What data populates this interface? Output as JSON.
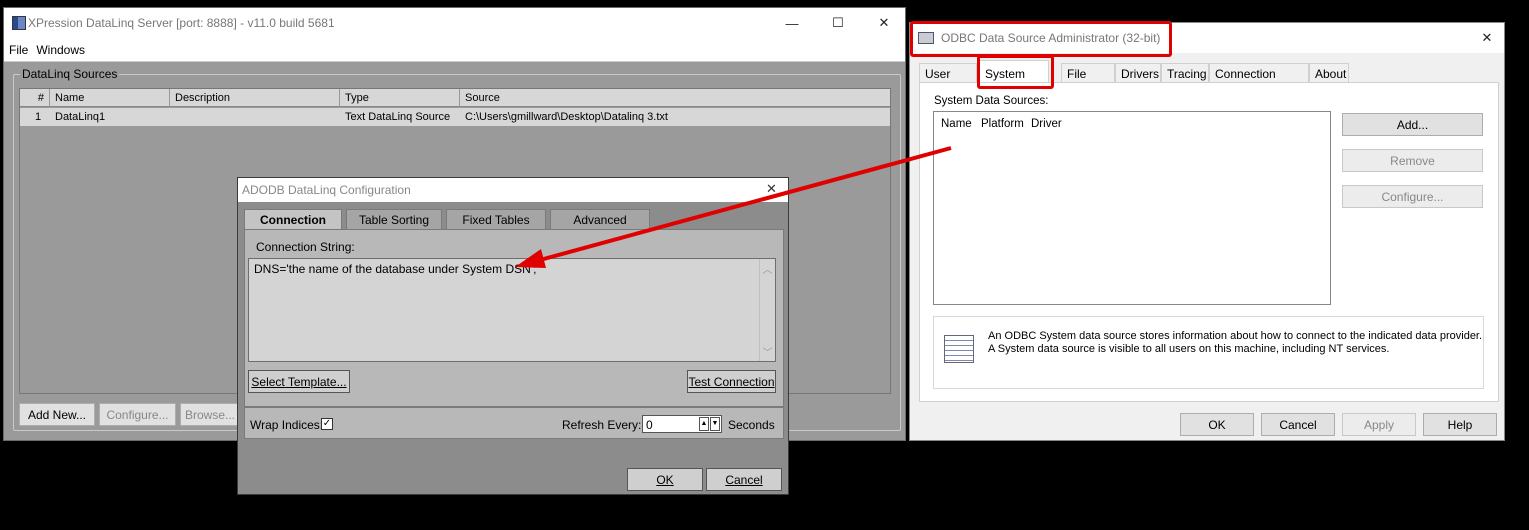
{
  "xpression": {
    "title": "XPression DataLinq Server [port: 8888] - v11.0 build 5681",
    "menu": [
      "File",
      "Windows"
    ],
    "group_label": "DataLinq Sources",
    "columns": [
      "#",
      "Name",
      "Description",
      "Type",
      "Source"
    ],
    "rows": [
      {
        "num": "1",
        "name": "DataLinq1",
        "description": "",
        "type": "Text DataLinq Source",
        "source": "C:\\Users\\gmillward\\Desktop\\Datalinq 3.txt"
      }
    ],
    "buttons": {
      "add_new": "Add New...",
      "configure": "Configure...",
      "browse": "Browse..."
    },
    "window_buttons": {
      "minimize": "—",
      "maximize": "☐",
      "close": "✕"
    }
  },
  "adodb": {
    "title": "ADODB DataLinq Configuration",
    "close": "✕",
    "tabs": [
      "Connection",
      "Table Sorting",
      "Fixed Tables",
      "Advanced"
    ],
    "selected_tab": "Connection",
    "connection_string_label": "Connection String:",
    "connection_string_value": "DNS='the name of the database under System DSN';",
    "select_template": "Select Template...",
    "test_connection": "Test Connection",
    "wrap_indices_label": "Wrap Indices:",
    "wrap_indices_checked": true,
    "refresh_label": "Refresh Every:",
    "refresh_value": "0",
    "refresh_unit": "Seconds",
    "ok": "OK",
    "cancel": "Cancel"
  },
  "odbc": {
    "title": "ODBC Data Source Administrator (32-bit)",
    "close": "✕",
    "tabs": [
      "User DSN",
      "System DSN",
      "File DSN",
      "Drivers",
      "Tracing",
      "Connection Pooling",
      "About"
    ],
    "selected_tab": "System DSN",
    "sources_label": "System Data Sources:",
    "list_columns": [
      "Name",
      "Platform",
      "Driver"
    ],
    "side_buttons": {
      "add": "Add...",
      "remove": "Remove",
      "configure": "Configure..."
    },
    "info_line1": "An ODBC System data source stores information about how to connect to the indicated data provider.",
    "info_line2": "A System data source is visible to all users on this machine, including NT services.",
    "bottom_buttons": {
      "ok": "OK",
      "cancel": "Cancel",
      "apply": "Apply",
      "help": "Help"
    }
  },
  "annotation_color": "#e00000"
}
